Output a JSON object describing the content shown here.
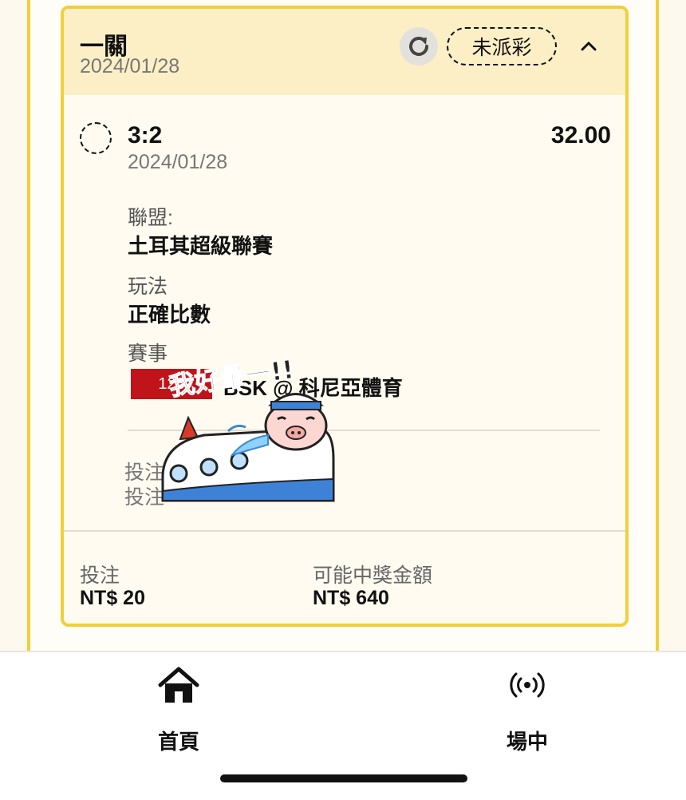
{
  "card": {
    "bet_type": "一關",
    "date": "2024/01/28",
    "status": "未派彩",
    "refresh_icon": "refresh-icon",
    "collapse_icon": "chevron-up-icon"
  },
  "selection": {
    "score": "3:2",
    "date": "2024/01/28",
    "odds": "32.00",
    "league_label": "聯盟:",
    "league_value": "土耳其超級聯賽",
    "market_label": "玩法",
    "market_value": "正確比數",
    "event_label": "賽事",
    "event_tag": "128",
    "event_name": "BSK @ 科尼亞體育",
    "bet_id_label": "投注",
    "bet_time_label": "投注"
  },
  "sticker": {
    "text": "我好暈一!!"
  },
  "footer": {
    "stake_label": "投注",
    "stake_value": "NT$ 20",
    "payout_label": "可能中獎金額",
    "payout_value": "NT$ 640"
  },
  "tabbar": {
    "home_label": "首頁",
    "home_icon": "home-icon",
    "live_label": "場中",
    "live_icon": "broadcast-icon"
  },
  "colors": {
    "accent": "#f2cf3a",
    "header_bg": "#fcefc6",
    "live_tag": "#c0141a"
  }
}
